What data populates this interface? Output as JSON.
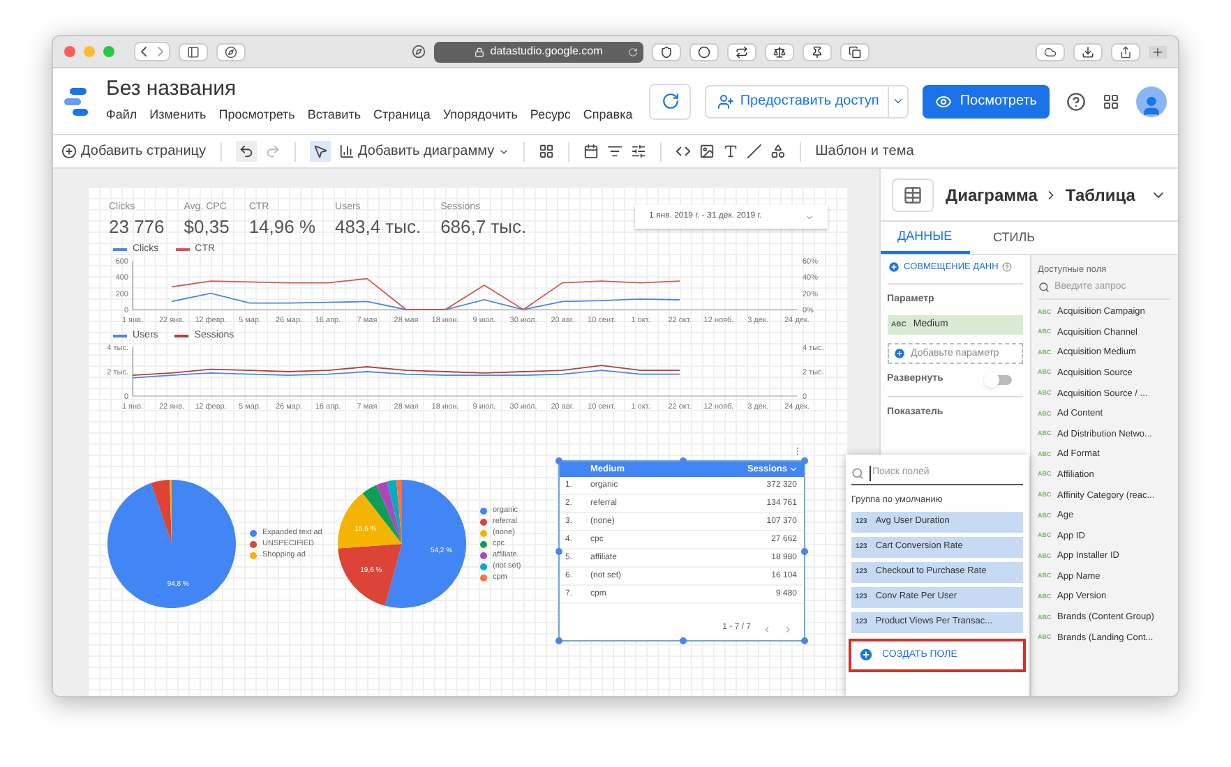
{
  "browser": {
    "url": "datastudio.google.com"
  },
  "app": {
    "title": "Без названия",
    "menu": [
      "Файл",
      "Изменить",
      "Просмотреть",
      "Вставить",
      "Страница",
      "Упорядочить",
      "Ресурс",
      "Справка"
    ],
    "share_button": "Предоставить доступ",
    "view_button": "Посмотреть"
  },
  "toolbar": {
    "add_page": "Добавить страницу",
    "add_chart": "Добавить диаграмму",
    "theme": "Шаблон и тема"
  },
  "report": {
    "scorecards": [
      {
        "label": "Clicks",
        "value": "23 776"
      },
      {
        "label": "Avg. CPC",
        "value": "$0,35"
      },
      {
        "label": "CTR",
        "value": "14,96 %"
      },
      {
        "label": "Users",
        "value": "483,4 тыс."
      },
      {
        "label": "Sessions",
        "value": "686,7 тыс."
      }
    ],
    "date_range": "1 янв. 2019 г. - 31 дек. 2019 г.",
    "line_charts": [
      {
        "chart_data": {
          "type": "line",
          "categories": [
            "1 янв.",
            "22 янв.",
            "12 февр.",
            "5 мар.",
            "26 мар.",
            "16 апр.",
            "7 мая",
            "28 мая",
            "18 июн.",
            "9 июл.",
            "30 июл.",
            "20 авг.",
            "10 сент.",
            "1 окт.",
            "22 окт.",
            "12 нояб.",
            "3 дек.",
            "24 дек."
          ],
          "ylim": [
            0,
            600
          ],
          "yticks": [
            0,
            200,
            400,
            600
          ],
          "series": [
            {
              "name": "Clicks",
              "color": "#4a86e8",
              "values": [
                null,
                100,
                200,
                80,
                80,
                90,
                100,
                0,
                0,
                120,
                0,
                100,
                110,
                130,
                120,
                null,
                null,
                null
              ]
            },
            {
              "name": "CTR",
              "color": "#d9534f",
              "axis": "y2",
              "values": [
                null,
                28,
                35,
                34,
                33,
                33,
                38,
                0,
                0,
                30,
                0,
                33,
                35,
                33,
                35,
                null,
                null,
                null
              ]
            }
          ],
          "y2lim": [
            0,
            60
          ],
          "y2ticks": [
            {
              "value": 0,
              "label": "0%"
            },
            {
              "value": 20,
              "label": "20%"
            },
            {
              "value": 40,
              "label": "40%"
            },
            {
              "value": 60,
              "label": "60%"
            }
          ]
        }
      },
      {
        "chart_data": {
          "type": "line",
          "categories": [
            "1 янв.",
            "22 янв.",
            "12 февр.",
            "5 мар.",
            "26 мар.",
            "16 апр.",
            "7 мая",
            "28 мая",
            "18 июн.",
            "9 июл.",
            "30 июл.",
            "20 авг.",
            "10 сент.",
            "1 окт.",
            "22 окт.",
            "12 нояб.",
            "3 дек.",
            "24 дек."
          ],
          "ylim": [
            0,
            4
          ],
          "yticks": [
            {
              "value": 0,
              "label": "0"
            },
            {
              "value": 2,
              "label": "2 тыс."
            },
            {
              "value": 4,
              "label": "4 тыс."
            }
          ],
          "series": [
            {
              "name": "Users",
              "color": "#4a86e8",
              "values": [
                1.5,
                1.7,
                1.9,
                1.8,
                1.7,
                1.8,
                2.0,
                1.8,
                1.7,
                1.7,
                1.7,
                1.8,
                2.1,
                1.8,
                1.8,
                null,
                null,
                null
              ]
            },
            {
              "name": "Sessions",
              "color": "#b0413e",
              "axis": "y2",
              "values": [
                1.7,
                1.9,
                2.2,
                2.1,
                2.0,
                2.1,
                2.4,
                2.1,
                2.0,
                1.9,
                2.0,
                2.1,
                2.5,
                2.1,
                2.1,
                null,
                null,
                null
              ]
            }
          ],
          "y2lim": [
            0,
            4
          ],
          "y2ticks": [
            {
              "value": 0,
              "label": "0"
            },
            {
              "value": 2,
              "label": "2 тыс."
            },
            {
              "value": 4,
              "label": "4 тыс."
            }
          ]
        }
      }
    ],
    "pie_charts": [
      {
        "chart_data": {
          "type": "pie",
          "values": [
            94.8,
            4.7,
            0.5
          ],
          "value_labels": [
            "94,8 %",
            null,
            null
          ]
        },
        "legend": [
          {
            "label": "Expanded text ad",
            "color": "#4285f4"
          },
          {
            "label": "UNSPECIFIED",
            "color": "#db4437"
          },
          {
            "label": "Shopping ad",
            "color": "#f4b400"
          }
        ]
      },
      {
        "chart_data": {
          "type": "pie",
          "values": [
            54.2,
            19.6,
            15.6,
            4.0,
            2.8,
            2.3,
            1.4
          ],
          "value_labels": [
            "54,2 %",
            "19,6 %",
            "15,6 %",
            null,
            null,
            null,
            null
          ]
        },
        "legend": [
          {
            "label": "organic",
            "color": "#4285f4"
          },
          {
            "label": "referral",
            "color": "#db4437"
          },
          {
            "label": "(none)",
            "color": "#f4b400"
          },
          {
            "label": "cpc",
            "color": "#0f9d58"
          },
          {
            "label": "affiliate",
            "color": "#ab47bc"
          },
          {
            "label": "(not set)",
            "color": "#00acc1"
          },
          {
            "label": "cpm",
            "color": "#ff7043"
          }
        ]
      }
    ],
    "table": {
      "selected": true,
      "columns": [
        "Medium",
        "Sessions"
      ],
      "rows": [
        {
          "index": "1.",
          "medium": "organic",
          "sessions": "372 320"
        },
        {
          "index": "2.",
          "medium": "referral",
          "sessions": "134 761"
        },
        {
          "index": "3.",
          "medium": "(none)",
          "sessions": "107 370"
        },
        {
          "index": "4.",
          "medium": "cpc",
          "sessions": "27 662"
        },
        {
          "index": "5.",
          "medium": "affiliate",
          "sessions": "18 980"
        },
        {
          "index": "6.",
          "medium": "(not set)",
          "sessions": "16 104"
        },
        {
          "index": "7.",
          "medium": "cpm",
          "sessions": "9 480"
        }
      ],
      "pagination": "1 - 7 / 7"
    }
  },
  "panel": {
    "breadcrumb": [
      "Диаграмма",
      "Таблица"
    ],
    "tabs": [
      {
        "label": "ДАННЫЕ",
        "selected": true
      },
      {
        "label": "СТИЛЬ",
        "selected": false
      }
    ],
    "blend_button": "СОВМЕЩЕНИЕ ДАНН",
    "dimension_label": "Параметр",
    "dimension": {
      "type": "ABC",
      "name": "Medium"
    },
    "add_dimension": "Добавьте параметр",
    "expand": {
      "label": "Развернуть",
      "on": false
    },
    "metric_label": "Показатель",
    "available_title": "Доступные поля",
    "available_search": {
      "placeholder": "Введите запрос"
    },
    "available_fields": [
      {
        "type": "ABC",
        "name": "Acquisition Campaign"
      },
      {
        "type": "ABC",
        "name": "Acquisition Channel"
      },
      {
        "type": "ABC",
        "name": "Acquisition Medium"
      },
      {
        "type": "ABC",
        "name": "Acquisition Source"
      },
      {
        "type": "ABC",
        "name": "Acquisition Source / ..."
      },
      {
        "type": "ABC",
        "name": "Ad Content"
      },
      {
        "type": "ABC",
        "name": "Ad Distribution Netwo..."
      },
      {
        "type": "ABC",
        "name": "Ad Format"
      },
      {
        "type": "ABC",
        "name": "Affiliation"
      },
      {
        "type": "ABC",
        "name": "Affinity Category (reac..."
      },
      {
        "type": "ABC",
        "name": "Age"
      },
      {
        "type": "ABC",
        "name": "App ID"
      },
      {
        "type": "ABC",
        "name": "App Installer ID"
      },
      {
        "type": "ABC",
        "name": "App Name"
      },
      {
        "type": "ABC",
        "name": "App Version"
      },
      {
        "type": "ABC",
        "name": "Brands (Content Group)"
      },
      {
        "type": "ABC",
        "name": "Brands (Landing Cont..."
      }
    ]
  },
  "field_picker": {
    "search": {
      "placeholder": "Поиск полей"
    },
    "group": "Группа по умолчанию",
    "fields": [
      {
        "type": "123",
        "name": "Avg User Duration"
      },
      {
        "type": "123",
        "name": "Cart Conversion Rate"
      },
      {
        "type": "123",
        "name": "Checkout to Purchase Rate"
      },
      {
        "type": "123",
        "name": "Conv Rate Per User"
      },
      {
        "type": "123",
        "name": "Product Views Per Transac..."
      }
    ],
    "create_button": "СОЗДАТЬ ПОЛЕ",
    "highlighted": true
  }
}
